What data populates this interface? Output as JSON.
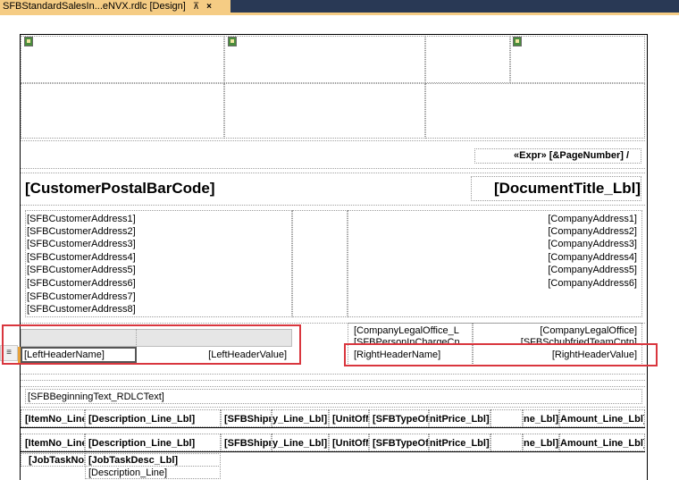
{
  "tab": {
    "title": "SFBStandardSalesIn...eNVX.rdlc [Design]",
    "pin": "⊼",
    "close": "×"
  },
  "header": {
    "page_number": "«Expr» [&PageNumber] /",
    "barcode": "[CustomerPostalBarCode]",
    "document_title": "[DocumentTitle_Lbl]"
  },
  "customer_address": [
    "[SFBCustomerAddress1]",
    "[SFBCustomerAddress2]",
    "[SFBCustomerAddress3]",
    "[SFBCustomerAddress4]",
    "[SFBCustomerAddress5]",
    "[SFBCustomerAddress6]",
    "[SFBCustomerAddress7]",
    "[SFBCustomerAddress8]"
  ],
  "company_address": [
    "[CompanyAddress1]",
    "[CompanyAddress2]",
    "[CompanyAddress3]",
    "[CompanyAddress4]",
    "[CompanyAddress5]",
    "[CompanyAddress6]"
  ],
  "info": {
    "company_legal_office_l": "[CompanyLegalOffice_L",
    "company_legal_office": "[CompanyLegalOffice]",
    "person_in_charge": "[SFBPersonInChargeCp",
    "schubfried_team": "[SFBSchubfriedTeamCptn]",
    "left_header_name": "[LeftHeaderName]",
    "left_header_value": "[LeftHeaderValue]",
    "right_header_name": "[RightHeaderName]",
    "right_header_value": "[RightHeaderValue]",
    "handle_glyph": "≡"
  },
  "beginning_text": "[SFBBeginningText_RDLCText]",
  "lines_header_1": [
    "[ItemNo_Line",
    "[Description_Line_Lbl]",
    "[SFBShipm",
    "y_Line_Lbl]",
    "[UnitOfM",
    "[SFBTypeOfL",
    "nitPrice_Lbl]",
    "",
    "ne_Lbl]",
    "Amount_Line_Lbl]"
  ],
  "lines_header_2": [
    "[ItemNo_Line",
    "[Description_Line_Lbl]",
    "[SFBShipm",
    "y_Line_Lbl]",
    "[UnitOfM",
    "[SFBTypeOfL",
    "nitPrice_Lbl]",
    "",
    "ne_Lbl]",
    "Amount_Line_Lbl]"
  ],
  "job": {
    "task_no": "[JobTaskNo",
    "task_desc": "[JobTaskDesc_Lbl]",
    "description_line": "[Description_Line]"
  },
  "colors": {
    "tab_bg": "#f5cc84",
    "tabbar_bg": "#293955",
    "highlight": "#d9363e"
  }
}
